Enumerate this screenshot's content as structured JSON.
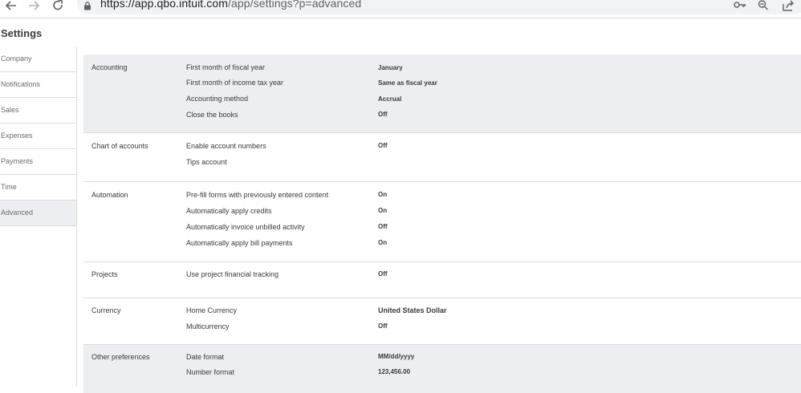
{
  "browser": {
    "url_host": "https://app.qbo.intuit.com",
    "url_path": "/app/settings?p=advanced"
  },
  "page": {
    "title": "Settings"
  },
  "sidebar": {
    "items": [
      {
        "label": "Company"
      },
      {
        "label": "Notifications"
      },
      {
        "label": "Sales"
      },
      {
        "label": "Expenses"
      },
      {
        "label": "Payments"
      },
      {
        "label": "Time"
      },
      {
        "label": "Advanced",
        "active": true
      }
    ]
  },
  "sections": {
    "accounting": {
      "title": "Accounting",
      "rows": [
        {
          "label": "First month of fiscal year",
          "value": "January"
        },
        {
          "label": "First month of income tax year",
          "value": "Same as fiscal year"
        },
        {
          "label": "Accounting method",
          "value": "Accrual"
        },
        {
          "label": "Close the books",
          "value": "Off"
        }
      ]
    },
    "chart_of_accounts": {
      "title": "Chart of accounts",
      "rows": [
        {
          "label": "Enable account numbers",
          "value": "Off"
        },
        {
          "label": "Tips account",
          "value": ""
        }
      ]
    },
    "automation": {
      "title": "Automation",
      "rows": [
        {
          "label": "Pre-fill forms with previously entered content",
          "value": "On"
        },
        {
          "label": "Automatically apply credits",
          "value": "On"
        },
        {
          "label": "Automatically invoice unbilled activity",
          "value": "Off"
        },
        {
          "label": "Automatically apply bill payments",
          "value": "On"
        }
      ]
    },
    "projects": {
      "title": "Projects",
      "rows": [
        {
          "label": "Use project financial tracking",
          "value": "Off"
        }
      ]
    },
    "currency": {
      "title": "Currency",
      "rows": [
        {
          "label": "Home Currency",
          "value": "United States Dollar"
        },
        {
          "label": "Multicurrency",
          "value": "Off"
        }
      ]
    },
    "other_preferences": {
      "title": "Other preferences",
      "rows": [
        {
          "label": "Date format",
          "value": "MM/dd/yyyy"
        },
        {
          "label": "Number format",
          "value": "123,456.00"
        }
      ]
    }
  },
  "icons": {
    "back": "back-arrow-icon",
    "forward": "forward-arrow-icon",
    "reload": "reload-icon",
    "lock": "lock-icon",
    "key": "key-icon",
    "zoom": "zoom-out-icon",
    "share": "share-icon"
  },
  "colors": {
    "shaded_section": "#eceef1",
    "active_sidebar": "#eceef1",
    "divider": "#dcdcdc",
    "text": "#393a3d",
    "muted_text": "#6b6c72"
  }
}
